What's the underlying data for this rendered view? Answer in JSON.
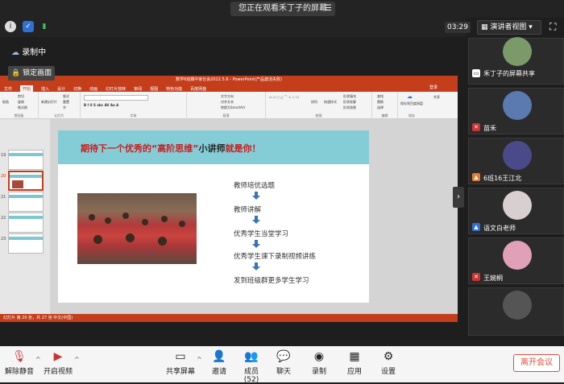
{
  "banner": {
    "text": "您正在观看禾丁子的屏幕",
    "menu_icon": "menu-icon"
  },
  "infobar": {
    "timer": "03:29",
    "presenter_view": "演讲者视图",
    "fullscreen_icon": "fullscreen-icon"
  },
  "recording": {
    "label": "录制中",
    "lock_view": "锁定画面"
  },
  "ppt": {
    "window_title": "数学6班期中家长会2022.5.6 - PowerPoint(产品激活失败)",
    "tabs": [
      "文件",
      "开始",
      "插入",
      "设计",
      "切换",
      "动画",
      "幻灯片放映",
      "审阅",
      "视图",
      "特色功能",
      "百度网盘"
    ],
    "active_tab": "开始",
    "login": "登录",
    "share": "共享",
    "ribbon_groups": [
      "剪贴板",
      "幻灯片",
      "字体",
      "段落",
      "绘图",
      "编辑",
      "保存"
    ],
    "ribbon_buttons": [
      "粘贴",
      "剪切",
      "复制",
      "格式刷",
      "新建幻灯片",
      "版式",
      "重置",
      "节",
      "文字方向",
      "对齐文本",
      "转换为SmartArt",
      "排列",
      "快速样式",
      "形状填充",
      "形状轮廓",
      "形状效果",
      "查找",
      "替换",
      "选择",
      "保存到百度网盘"
    ],
    "thumbnail_numbers": [
      "19",
      "20",
      "21",
      "22",
      "23"
    ],
    "status": "幻灯片 第 20 张，共 27 张    中文(中国)",
    "slide": {
      "title_red1": "期待下一个优秀的",
      "title_quote": "“高阶思维”",
      "title_black": "小讲师",
      "title_red2": "就是你！",
      "flow": [
        "教师培优选题",
        "教师讲解",
        "优秀学生当堂学习",
        "优秀学生课下录制视频讲练",
        "发到班级群更多学生学习"
      ]
    }
  },
  "participants": [
    {
      "name": "禾丁子的屏幕共享",
      "avatar_color": "#7a9a6a"
    },
    {
      "name": "苗禾",
      "avatar_color": "#5a7ab0"
    },
    {
      "name": "6班16王江北",
      "avatar_color": "#4a4a8a"
    },
    {
      "name": "语文白老师",
      "avatar_color": "#d8d0d0"
    },
    {
      "name": "王婉桐",
      "avatar_color": "#e0a0b8"
    },
    {
      "name": "",
      "avatar_color": "#2b2b2b"
    }
  ],
  "toolbar": {
    "mute": "解除静音",
    "video": "开启视频",
    "share": "共享屏幕",
    "invite": "邀请",
    "members": "成员(52)",
    "chat": "聊天",
    "record": "录制",
    "apps": "应用",
    "settings": "设置",
    "leave": "离开会议"
  },
  "colors": {
    "ppt_accent": "#c43e1c",
    "slide_header": "#85cdd6",
    "slide_title": "#c81e1e",
    "leave": "#e34d3d"
  }
}
